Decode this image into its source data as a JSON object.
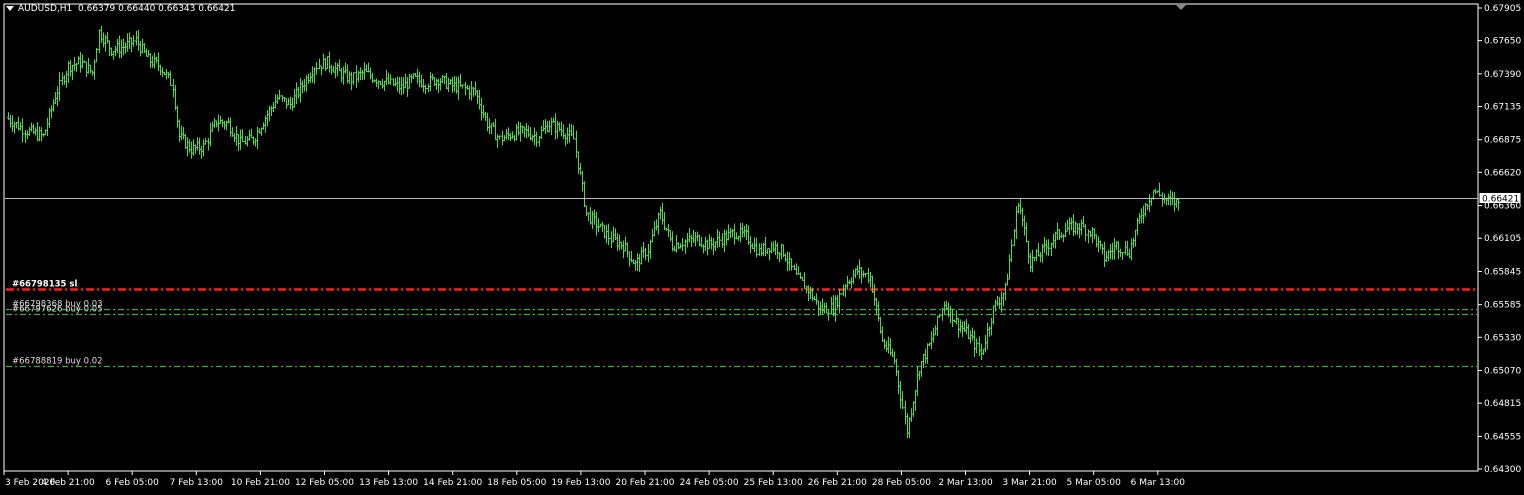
{
  "header": {
    "symbol": "AUDUSD,H1",
    "ohlc": "0.66379 0.66440 0.66343 0.66421"
  },
  "colors": {
    "background": "#000000",
    "frame": "#ffffff",
    "candles": "#4cd94c",
    "bid_line": "#b8b8b8",
    "sl_line": "#ff2020",
    "buy_line": "#3caa3c"
  },
  "chart_data": {
    "type": "bar",
    "symbol": "AUDUSD",
    "timeframe": "H1",
    "ylim": [
      0.643,
      0.67905
    ],
    "y_ticks": [
      "0.67905",
      "0.67650",
      "0.67390",
      "0.67135",
      "0.66875",
      "0.66620",
      "0.66360",
      "0.66105",
      "0.65845",
      "0.65585",
      "0.65330",
      "0.65070",
      "0.64815",
      "0.64555",
      "0.64300"
    ],
    "x_ticks": [
      "3 Feb 2020",
      "4 Feb 21:00",
      "6 Feb 05:00",
      "7 Feb 13:00",
      "10 Feb 21:00",
      "12 Feb 05:00",
      "13 Feb 13:00",
      "14 Feb 21:00",
      "18 Feb 05:00",
      "19 Feb 13:00",
      "20 Feb 21:00",
      "24 Feb 05:00",
      "25 Feb 13:00",
      "26 Feb 21:00",
      "28 Feb 05:00",
      "2 Mar 13:00",
      "3 Mar 21:00",
      "5 Mar 05:00",
      "6 Mar 13:00"
    ],
    "path": [
      [
        0,
        0.6705
      ],
      [
        3,
        0.6695
      ],
      [
        6,
        0.669
      ],
      [
        8,
        0.6722
      ],
      [
        10,
        0.6745
      ],
      [
        12,
        0.6748
      ],
      [
        14,
        0.674
      ],
      [
        15,
        0.6772
      ],
      [
        17,
        0.6758
      ],
      [
        19,
        0.676
      ],
      [
        21,
        0.6765
      ],
      [
        23,
        0.675
      ],
      [
        25,
        0.6745
      ],
      [
        27,
        0.673
      ],
      [
        28,
        0.669
      ],
      [
        30,
        0.668
      ],
      [
        32,
        0.6682
      ],
      [
        34,
        0.6702
      ],
      [
        36,
        0.67
      ],
      [
        38,
        0.6685
      ],
      [
        40,
        0.6688
      ],
      [
        42,
        0.6705
      ],
      [
        44,
        0.672
      ],
      [
        46,
        0.6715
      ],
      [
        48,
        0.673
      ],
      [
        50,
        0.6745
      ],
      [
        52,
        0.6748
      ],
      [
        54,
        0.674
      ],
      [
        56,
        0.6735
      ],
      [
        58,
        0.674
      ],
      [
        60,
        0.6735
      ],
      [
        62,
        0.6732
      ],
      [
        64,
        0.6728
      ],
      [
        66,
        0.6735
      ],
      [
        68,
        0.6732
      ],
      [
        70,
        0.6735
      ],
      [
        72,
        0.673
      ],
      [
        74,
        0.6728
      ],
      [
        76,
        0.6725
      ],
      [
        78,
        0.67
      ],
      [
        80,
        0.6688
      ],
      [
        82,
        0.6692
      ],
      [
        84,
        0.6694
      ],
      [
        86,
        0.669
      ],
      [
        88,
        0.67
      ],
      [
        90,
        0.6695
      ],
      [
        92,
        0.6688
      ],
      [
        94,
        0.663
      ],
      [
        96,
        0.662
      ],
      [
        98,
        0.661
      ],
      [
        100,
        0.6605
      ],
      [
        102,
        0.659
      ],
      [
        104,
        0.6602
      ],
      [
        106,
        0.663
      ],
      [
        108,
        0.6605
      ],
      [
        110,
        0.6608
      ],
      [
        112,
        0.661
      ],
      [
        114,
        0.6605
      ],
      [
        116,
        0.661
      ],
      [
        118,
        0.6615
      ],
      [
        120,
        0.6612
      ],
      [
        122,
        0.66
      ],
      [
        124,
        0.6605
      ],
      [
        126,
        0.66
      ],
      [
        128,
        0.658
      ],
      [
        130,
        0.657
      ],
      [
        132,
        0.6555
      ],
      [
        134,
        0.6556
      ],
      [
        136,
        0.6575
      ],
      [
        138,
        0.6585
      ],
      [
        140,
        0.658
      ],
      [
        142,
        0.653
      ],
      [
        144,
        0.6515
      ],
      [
        146,
        0.646
      ],
      [
        148,
        0.651
      ],
      [
        150,
        0.653
      ],
      [
        152,
        0.656
      ],
      [
        154,
        0.6545
      ],
      [
        156,
        0.6535
      ],
      [
        158,
        0.652
      ],
      [
        160,
        0.6555
      ],
      [
        162,
        0.657
      ],
      [
        164,
        0.664
      ],
      [
        166,
        0.6592
      ],
      [
        168,
        0.66
      ],
      [
        170,
        0.6612
      ],
      [
        172,
        0.6618
      ],
      [
        174,
        0.662
      ],
      [
        176,
        0.6615
      ],
      [
        178,
        0.6595
      ],
      [
        180,
        0.6605
      ],
      [
        182,
        0.66
      ],
      [
        184,
        0.663
      ],
      [
        186,
        0.6648
      ],
      [
        188,
        0.664
      ],
      [
        190,
        0.6638
      ]
    ],
    "levels": [
      {
        "label": "#66798135 sl",
        "price": 0.6571,
        "kind": "sl"
      },
      {
        "label": "#66798368 buy 0.03",
        "price": 0.65555,
        "kind": "buy"
      },
      {
        "label": "#66797626 buy 0.05",
        "price": 0.6551,
        "kind": "buy"
      },
      {
        "label": "#66788819 buy 0.02",
        "price": 0.65105,
        "kind": "buy"
      }
    ],
    "bid": {
      "price": 0.66421,
      "label": "0.66421"
    }
  }
}
